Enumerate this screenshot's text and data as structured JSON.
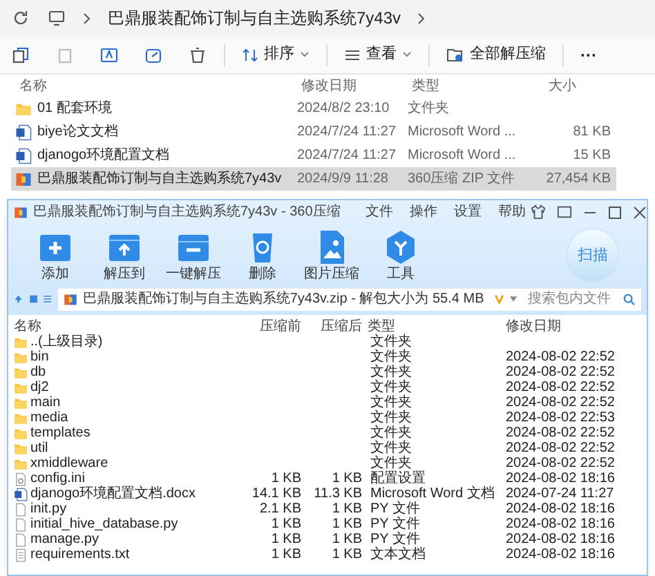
{
  "explorer": {
    "breadcrumb": [
      "巴鼎服装配饰订制与自主选购系统7y43v"
    ],
    "toolbar": {
      "sort": "排序",
      "view": "查看",
      "extract": "全部解压缩",
      "more": "···"
    },
    "columns": [
      "名称",
      "修改日期",
      "类型",
      "大小"
    ],
    "rows": [
      {
        "kind": "folder",
        "name": "01 配套环境",
        "date": "2024/8/2 23:10",
        "type": "文件夹",
        "size": "",
        "selected": false
      },
      {
        "kind": "word",
        "name": "biye论文文档",
        "date": "2024/7/24 11:27",
        "type": "Microsoft Word ...",
        "size": "81 KB",
        "selected": false
      },
      {
        "kind": "word",
        "name": "djanogo环境配置文档",
        "date": "2024/7/24 11:27",
        "type": "Microsoft Word ...",
        "size": "15 KB",
        "selected": false
      },
      {
        "kind": "zip",
        "name": "巴鼎服装配饰订制与自主选购系统7y43v",
        "date": "2024/9/9 11:28",
        "type": "360压缩 ZIP 文件",
        "size": "27,454 KB",
        "selected": true
      }
    ]
  },
  "zip_window": {
    "title": "巴鼎服装配饰订制与自主选购系统7y43v - 360压缩",
    "menu": [
      "文件",
      "操作",
      "设置",
      "帮助"
    ],
    "tools": [
      {
        "kind": "add",
        "label": "添加"
      },
      {
        "kind": "extract_to",
        "label": "解压到"
      },
      {
        "kind": "one_click",
        "label": "一键解压"
      },
      {
        "kind": "delete",
        "label": "删除"
      },
      {
        "kind": "image",
        "label": "图片压缩"
      },
      {
        "kind": "tools",
        "label": "工具"
      }
    ],
    "scan": "扫描",
    "path": "巴鼎服装配饰订制与自主选购系统7y43v.zip - 解包大小为 55.4 MB",
    "search": {
      "placeholder": "搜索包内文件"
    },
    "columns": [
      "名称",
      "压缩前",
      "压缩后",
      "类型",
      "修改日期"
    ],
    "rows": [
      {
        "kind": "folder",
        "name": "..(上级目录)",
        "before": "",
        "after": "",
        "type": "文件夹",
        "date": ""
      },
      {
        "kind": "folder",
        "name": "bin",
        "before": "",
        "after": "",
        "type": "文件夹",
        "date": "2024-08-02 22:52"
      },
      {
        "kind": "folder",
        "name": "db",
        "before": "",
        "after": "",
        "type": "文件夹",
        "date": "2024-08-02 22:52"
      },
      {
        "kind": "folder",
        "name": "dj2",
        "before": "",
        "after": "",
        "type": "文件夹",
        "date": "2024-08-02 22:52"
      },
      {
        "kind": "folder",
        "name": "main",
        "before": "",
        "after": "",
        "type": "文件夹",
        "date": "2024-08-02 22:52"
      },
      {
        "kind": "folder",
        "name": "media",
        "before": "",
        "after": "",
        "type": "文件夹",
        "date": "2024-08-02 22:53"
      },
      {
        "kind": "folder",
        "name": "templates",
        "before": "",
        "after": "",
        "type": "文件夹",
        "date": "2024-08-02 22:52"
      },
      {
        "kind": "folder",
        "name": "util",
        "before": "",
        "after": "",
        "type": "文件夹",
        "date": "2024-08-02 22:52"
      },
      {
        "kind": "folder",
        "name": "xmiddleware",
        "before": "",
        "after": "",
        "type": "文件夹",
        "date": "2024-08-02 22:52"
      },
      {
        "kind": "ini",
        "name": "config.ini",
        "before": "1 KB",
        "after": "1 KB",
        "type": "配置设置",
        "date": "2024-08-02 18:16"
      },
      {
        "kind": "word",
        "name": "djanogo环境配置文档.docx",
        "before": "14.1 KB",
        "after": "11.3 KB",
        "type": "Microsoft Word 文档",
        "date": "2024-07-24 11:27"
      },
      {
        "kind": "file",
        "name": "init.py",
        "before": "2.1 KB",
        "after": "1 KB",
        "type": "PY 文件",
        "date": "2024-08-02 18:16"
      },
      {
        "kind": "file",
        "name": "initial_hive_database.py",
        "before": "1 KB",
        "after": "1 KB",
        "type": "PY 文件",
        "date": "2024-08-02 18:16"
      },
      {
        "kind": "file",
        "name": "manage.py",
        "before": "1 KB",
        "after": "1 KB",
        "type": "PY 文件",
        "date": "2024-08-02 18:16"
      },
      {
        "kind": "text",
        "name": "requirements.txt",
        "before": "1 KB",
        "after": "1 KB",
        "type": "文本文档",
        "date": "2024-08-02 18:16"
      }
    ]
  }
}
